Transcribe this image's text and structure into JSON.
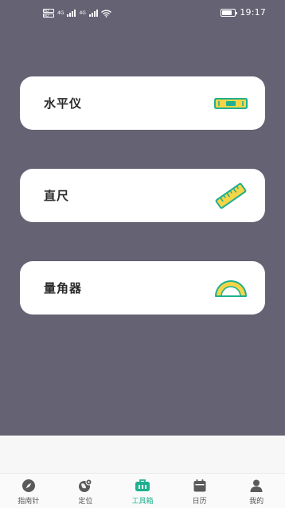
{
  "status_bar": {
    "time": "19:17",
    "sim1": "HD",
    "sim2": "HD",
    "network1": "4G",
    "network2": "4G",
    "battery_level": 0.75
  },
  "tools": [
    {
      "label": "水平仪",
      "icon": "level-tool-icon"
    },
    {
      "label": "直尺",
      "icon": "ruler-icon"
    },
    {
      "label": "量角器",
      "icon": "protractor-icon"
    }
  ],
  "tab_bar": {
    "active_index": 2,
    "items": [
      {
        "label": "指南针",
        "icon": "compass-icon"
      },
      {
        "label": "定位",
        "icon": "globe-location-icon"
      },
      {
        "label": "工具箱",
        "icon": "toolbox-icon"
      },
      {
        "label": "日历",
        "icon": "calendar-icon"
      },
      {
        "label": "我的",
        "icon": "user-icon"
      }
    ]
  },
  "colors": {
    "background": "#656274",
    "card": "#ffffff",
    "accent_green": "#1fb08f",
    "icon_yellow": "#f5d547",
    "tab_inactive": "#5a5a5a"
  }
}
